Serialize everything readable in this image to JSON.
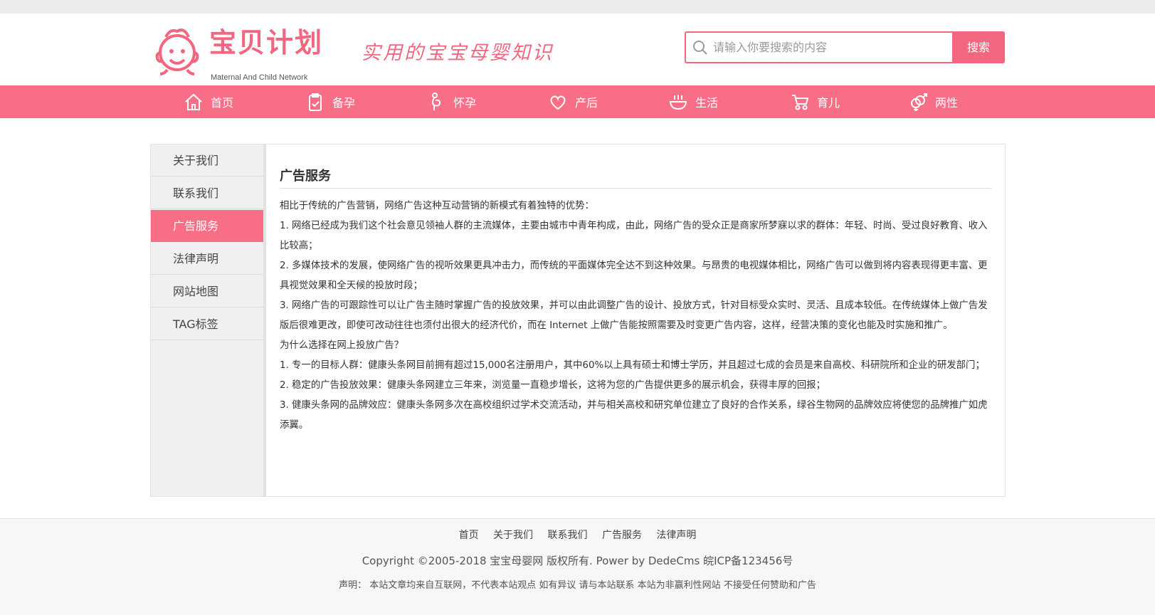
{
  "logo": {
    "title": "宝贝计划",
    "subtitle": "Maternal And Child Network",
    "slogan": "实用的宝宝母婴知识"
  },
  "search": {
    "placeholder": "请输入你要搜索的内容",
    "button_label": "搜索"
  },
  "nav": [
    {
      "label": "首页",
      "icon": "home-icon"
    },
    {
      "label": "备孕",
      "icon": "clipboard-icon"
    },
    {
      "label": "怀孕",
      "icon": "pregnant-icon"
    },
    {
      "label": "产后",
      "icon": "heart-hand-icon"
    },
    {
      "label": "生活",
      "icon": "bowl-icon"
    },
    {
      "label": "育儿",
      "icon": "stroller-icon"
    },
    {
      "label": "两性",
      "icon": "gender-icon"
    }
  ],
  "sidebar": [
    {
      "label": "关于我们",
      "active": false
    },
    {
      "label": "联系我们",
      "active": false
    },
    {
      "label": "广告服务",
      "active": true
    },
    {
      "label": "法律声明",
      "active": false
    },
    {
      "label": "网站地图",
      "active": false
    },
    {
      "label": "TAG标签",
      "active": false
    }
  ],
  "content": {
    "title": "广告服务",
    "paragraphs": [
      "相比于传统的广告营销，网络广告这种互动营销的新模式有着独特的优势：",
      "1. 网络已经成为我们这个社会意见领袖人群的主流媒体，主要由城市中青年构成，由此，网络广告的受众正是商家所梦寐以求的群体：年轻、时尚、受过良好教育、收入比较高；",
      "2. 多媒体技术的发展，使网络广告的视听效果更具冲击力，而传统的平面媒体完全达不到这种效果。与昂贵的电视媒体相比，网络广告可以做到将内容表现得更丰富、更具视觉效果和全天候的投放时段；",
      "3. 网络广告的可跟踪性可以让广告主随时掌握广告的投放效果，并可以由此调整广告的设计、投放方式，针对目标受众实时、灵活、且成本较低。在传统媒体上做广告发版后很难更改，即使可改动往往也须付出很大的经济代价，而在 Internet 上做广告能按照需要及时变更广告内容，这样，经营决策的变化也能及时实施和推广。",
      "为什么选择在网上投放广告？",
      "1. 专一的目标人群：健康头条网目前拥有超过15,000名注册用户，其中60%以上具有硕士和博士学历，并且超过七成的会员是来自高校、科研院所和企业的研发部门；",
      "2. 稳定的广告投放效果：健康头条网建立三年来，浏览量一直稳步增长，这将为您的广告提供更多的展示机会，获得丰厚的回报；",
      "3. 健康头条网的品牌效应：健康头条网多次在高校组织过学术交流活动，并与相关高校和研究单位建立了良好的合作关系，绿谷生物网的品牌效应将使您的品牌推广如虎添翼。"
    ]
  },
  "footer": {
    "links": [
      "首页",
      "关于我们",
      "联系我们",
      "广告服务",
      "法律声明"
    ],
    "copyright": "Copyright ©2005-2018 宝宝母婴网 版权所有. Power by DedeCms 皖ICP备123456号",
    "statement": "声明： 本站文章均来自互联网，不代表本站观点 如有异议 请与本站联系 本站为非赢利性网站 不接受任何赞助和广告"
  },
  "colors": {
    "brand_pink": "#f96e87",
    "logo_pink": "#f2677f"
  }
}
